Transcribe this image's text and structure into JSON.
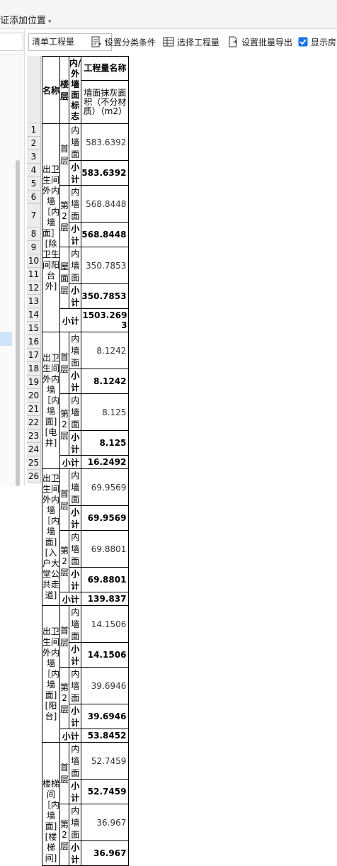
{
  "topbar": {
    "title": "证添加位置"
  },
  "toolbar": {
    "select_value": "清单工程量",
    "btn_classify": "设置分类条件",
    "btn_select": "选择工程量",
    "btn_export": "设置批量导出",
    "chk_label": "显示房"
  },
  "table": {
    "headers": {
      "name": "名称",
      "floor": "楼层",
      "wall_flag": "内/外墙面标志",
      "qty": "工程量名称",
      "qty_sub": "墙面抹灰面积（不分材质）（m2）"
    },
    "row_numbers": [
      "1",
      "2",
      "3",
      "4",
      "5",
      "6",
      "7",
      "8",
      "9",
      "10",
      "11",
      "12",
      "13",
      "14",
      "15",
      "16",
      "17",
      "18",
      "19",
      "20",
      "21",
      "22",
      "23",
      "24",
      "25",
      "26"
    ],
    "inner": "内墙面",
    "subtotal": "小计",
    "groups": [
      {
        "name": "出卫生间外内墙［内墙面］[除卫生间阳台外]",
        "floors": [
          {
            "floor": "首层",
            "inner_val": "583.6392",
            "sub_val": "583.6392"
          },
          {
            "floor": "第2层",
            "inner_val": "568.8448",
            "sub_val": "568.8448"
          },
          {
            "floor": "屋面层",
            "inner_val": "350.7853",
            "sub_val": "350.7853"
          }
        ],
        "total": "1503.2693"
      },
      {
        "name": "出卫生间外内墙［内墙面][电井]",
        "floors": [
          {
            "floor": "首层",
            "inner_val": "8.1242",
            "sub_val": "8.1242"
          },
          {
            "floor": "第2层",
            "inner_val": "8.125",
            "sub_val": "8.125"
          }
        ],
        "total": "16.2492"
      },
      {
        "name": "出卫生间外内墙［内墙面][入户大堂公共走道]",
        "floors": [
          {
            "floor": "首层",
            "inner_val": "69.9569",
            "sub_val": "69.9569"
          },
          {
            "floor": "第2层",
            "inner_val": "69.8801",
            "sub_val": "69.8801"
          }
        ],
        "total": "139.837"
      },
      {
        "name": "出卫生间外内墙［内墙面][阳台]",
        "floors": [
          {
            "floor": "首层",
            "inner_val": "14.1506",
            "sub_val": "14.1506"
          },
          {
            "floor": "第2层",
            "inner_val": "39.6946",
            "sub_val": "39.6946"
          }
        ],
        "total": "53.8452"
      },
      {
        "name": "楼梯间［内墙面][楼梯间]",
        "floors": [
          {
            "floor": "首层",
            "inner_val": "52.7459",
            "sub_val": "52.7459"
          },
          {
            "floor": "第2层",
            "inner_val": "36.967",
            "sub_val": "36.967"
          }
        ]
      }
    ]
  },
  "colors": {
    "checkbox": "#1a73e8",
    "selection": "#cde3f7"
  }
}
